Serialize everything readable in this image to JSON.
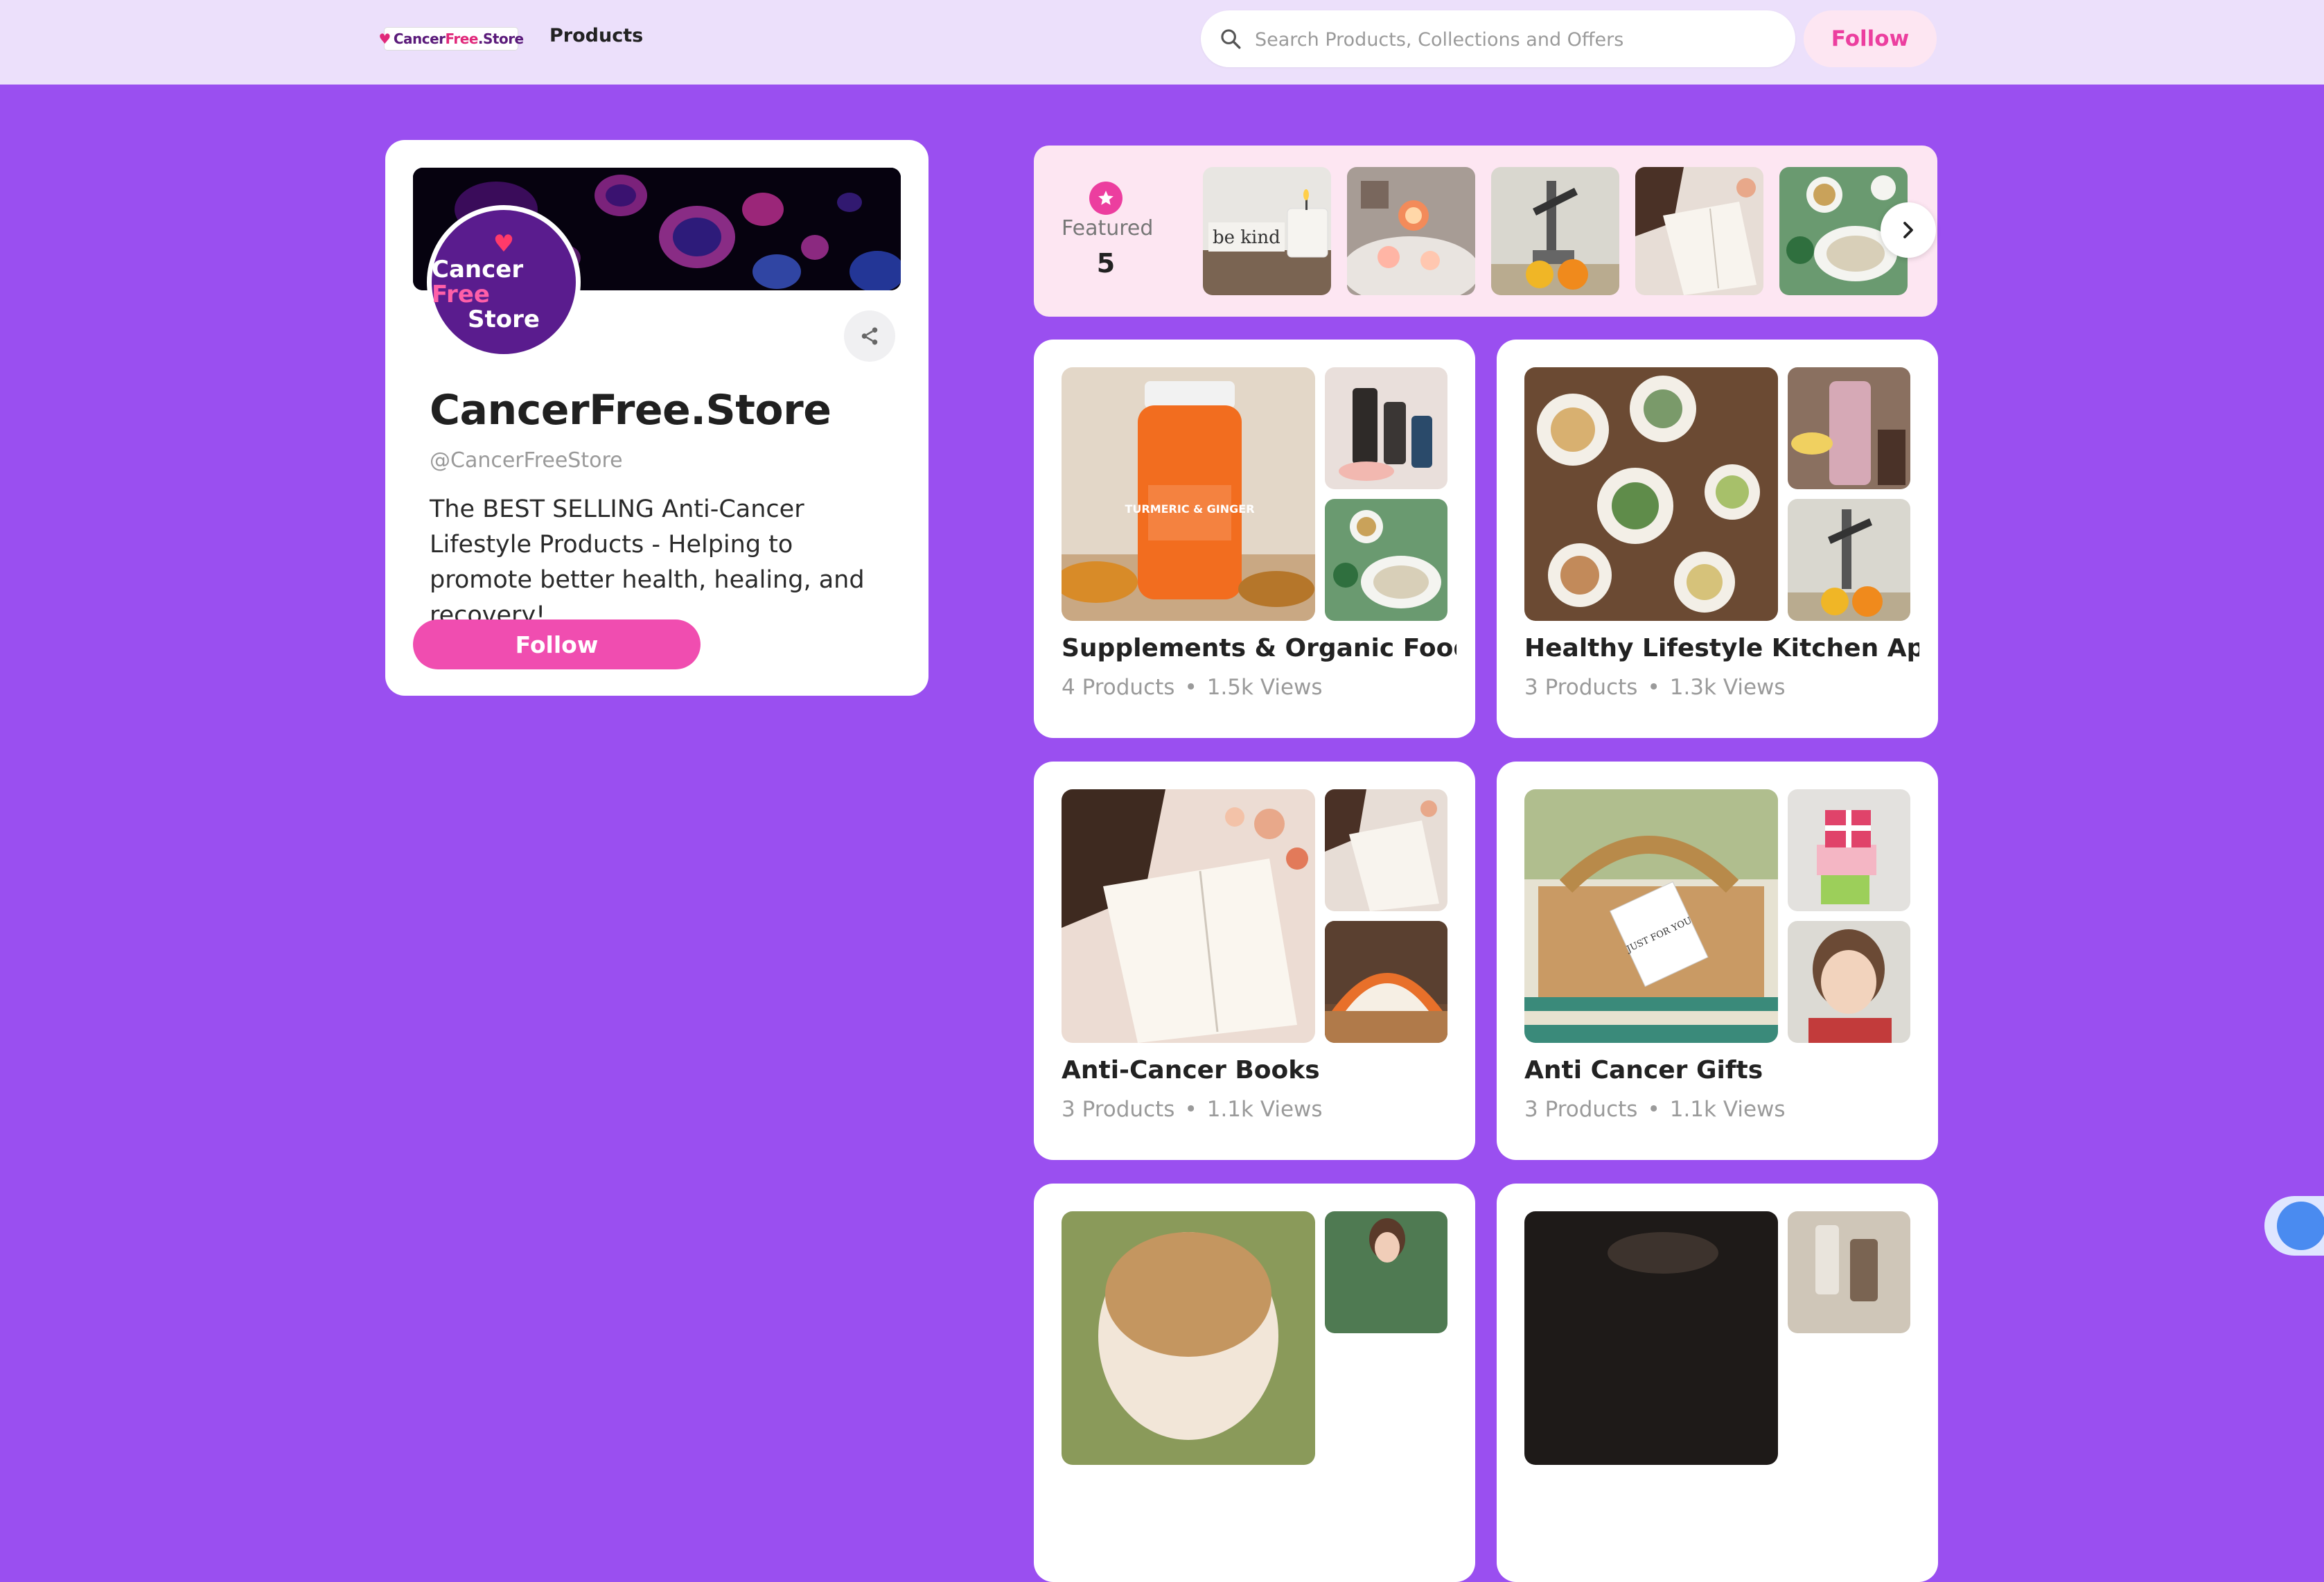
{
  "header": {
    "logo_text_left": "Cancer",
    "logo_text_mid": "Free",
    "logo_text_right": ".Store",
    "nav_products": "Products",
    "search_placeholder": "Search Products, Collections and Offers",
    "follow_label": "Follow"
  },
  "profile": {
    "avatar_line1_a": "Cancer",
    "avatar_line1_b": "Free",
    "avatar_line2": "Store",
    "name": "CancerFree.Store",
    "handle": "@CancerFreeStore",
    "bio": "The BEST SELLING Anti-Cancer Lifestyle Products - Helping to promote better health, healing, and recovery!",
    "follow_label": "Follow"
  },
  "featured": {
    "label": "Featured",
    "count": "5",
    "thumb1_text": "be kind"
  },
  "collections": [
    {
      "title": "Supplements & Organic Foods",
      "products": "4 Products",
      "views": "1.5k Views",
      "jar_label": "TURMERIC & GINGER"
    },
    {
      "title": "Healthy Lifestyle Kitchen Appli...",
      "products": "3 Products",
      "views": "1.3k Views"
    },
    {
      "title": "Anti-Cancer Books",
      "products": "3 Products",
      "views": "1.1k Views"
    },
    {
      "title": "Anti Cancer Gifts",
      "products": "3 Products",
      "views": "1.1k Views",
      "tag_text": "JUST FOR YOU"
    }
  ],
  "colors": {
    "background": "#9a4ff0",
    "topbar": "#ece0fb",
    "accent_pink": "#ec3e9f",
    "featured_bg": "#fde6f2"
  },
  "icons": [
    "search-icon",
    "share-icon",
    "star-icon",
    "chevron-right-icon",
    "chat-widget-icon"
  ]
}
